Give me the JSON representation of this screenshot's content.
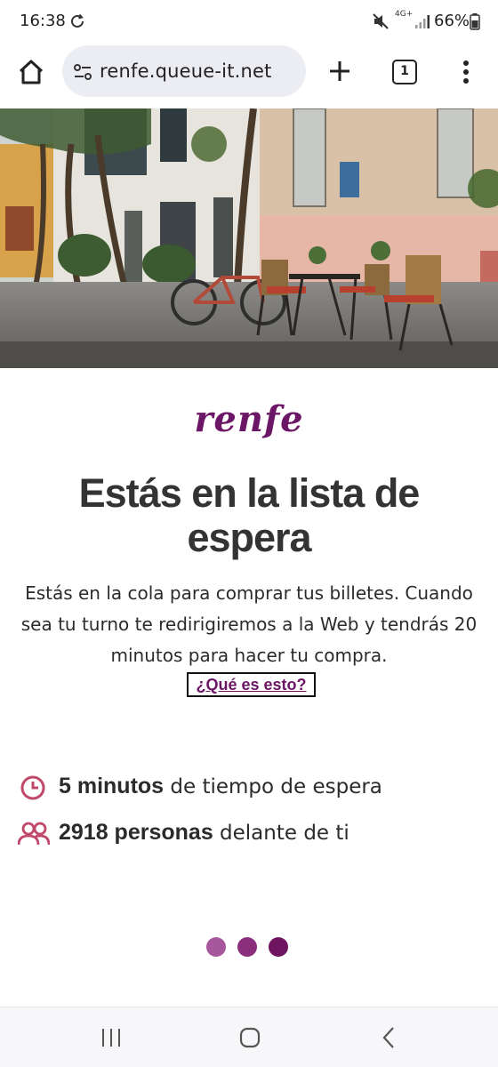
{
  "status": {
    "time": "16:38",
    "network": "4G+",
    "battery": "66%",
    "icons": [
      "sync-icon",
      "mute-icon",
      "signal-icon",
      "battery-icon"
    ]
  },
  "browser": {
    "url": "renfe.queue-it.net",
    "tab_count": "1",
    "icons": [
      "home-icon",
      "site-settings-icon",
      "plus-icon",
      "tabs-icon",
      "kebab-menu-icon"
    ]
  },
  "main": {
    "logo": "renfe",
    "title": "Estás en la lista de espera",
    "description": "Estás en la cola para comprar tus billetes. Cuando sea tu turno te redirigiremos a la Web y tendrás 20 minutos para hacer tu compra.",
    "help_link": "¿Qué es esto?",
    "wait": {
      "value": "5 minutos",
      "text": " de tiempo de espera"
    },
    "people": {
      "value": "2918 personas",
      "text": " delante de ti"
    }
  },
  "colors": {
    "brand": "#6b1766",
    "accent_icon": "#c0486a",
    "dots": [
      "#a7589c",
      "#8b2f7c",
      "#6e1560"
    ]
  },
  "nav": {
    "icons": [
      "recent-apps-icon",
      "home-circle-icon",
      "back-icon"
    ]
  }
}
